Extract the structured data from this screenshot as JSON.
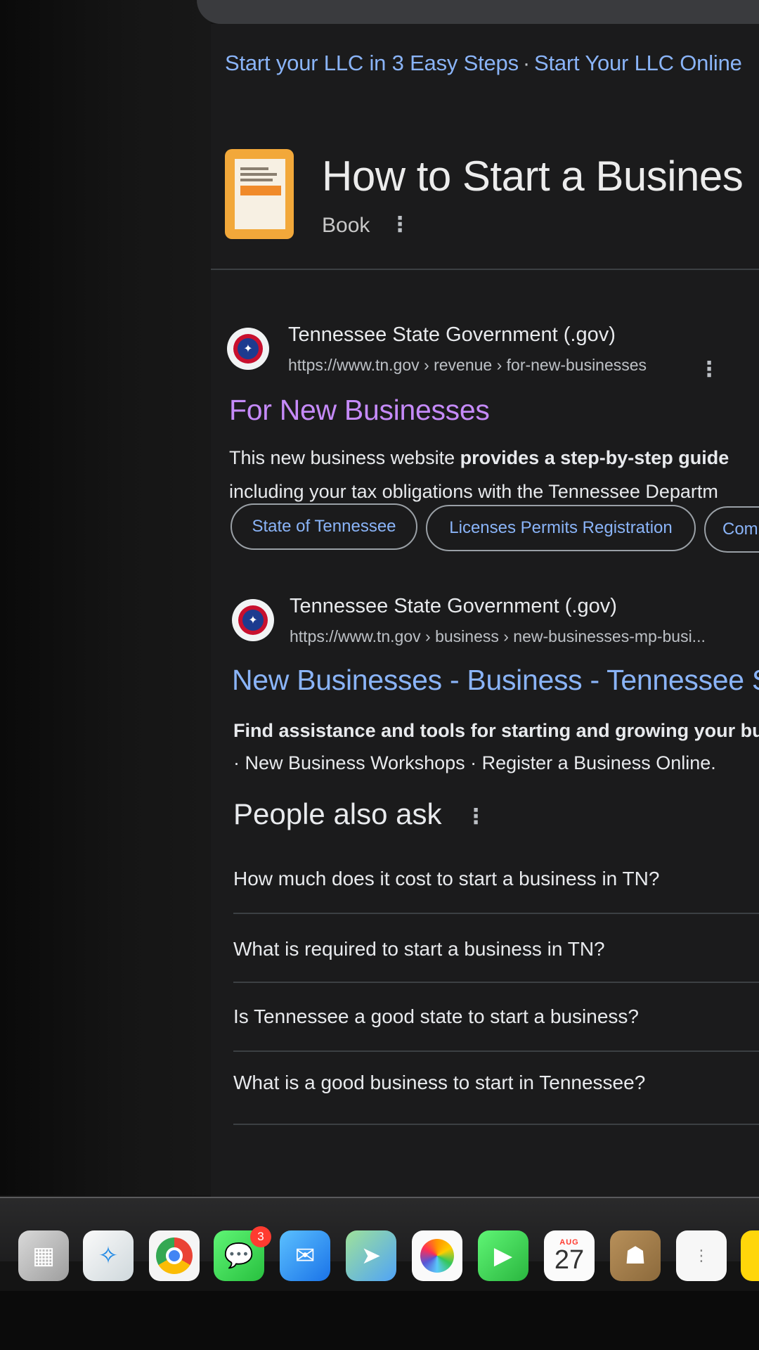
{
  "sitelinks": [
    "Start your LLC in 3 Easy Steps",
    "Start Your LLC Online"
  ],
  "sitelinks_sep": "·",
  "book_panel": {
    "title": "How to Start a Busines",
    "subtitle": "Book"
  },
  "results": [
    {
      "site_name": "Tennessee State Government (.gov)",
      "url": "https://www.tn.gov › revenue › for-new-businesses",
      "title": "For New Businesses",
      "snippet_line1_plain": "This new business website ",
      "snippet_line1_bold": "provides a step-by-step guide",
      "snippet_line2": "including your tax obligations with the Tennessee Departm",
      "chips": [
        "State of Tennessee",
        "Licenses Permits Registration",
        "Com"
      ]
    },
    {
      "site_name": "Tennessee State Government (.gov)",
      "url": "https://www.tn.gov › business › new-businesses-mp-busi...",
      "title": "New Businesses - Business - Tennessee S",
      "snippet_line1_bold": "Find assistance and tools for starting and growing your bus",
      "snippet_line2": "· New Business Workshops · Register a Business Online."
    }
  ],
  "people_also_ask": {
    "title": "People also ask",
    "questions": [
      "How much does it cost to start a business in TN?",
      "What is required to start a business in TN?",
      "Is Tennessee a good state to start a business?",
      "What is a good business to start in Tennessee?"
    ]
  },
  "dock": {
    "messages_badge": "3",
    "calendar_month": "AUG",
    "calendar_day": "27",
    "icons": [
      "launchpad-icon",
      "safari-icon",
      "chrome-icon",
      "messages-icon",
      "mail-icon",
      "maps-icon",
      "photos-icon",
      "facetime-icon",
      "calendar-icon",
      "contacts-icon",
      "reminders-icon",
      "notes-icon"
    ]
  },
  "colors": {
    "link_blue": "#8ab4f8",
    "visited_purple": "#c58af9",
    "background": "#1b1b1c"
  }
}
